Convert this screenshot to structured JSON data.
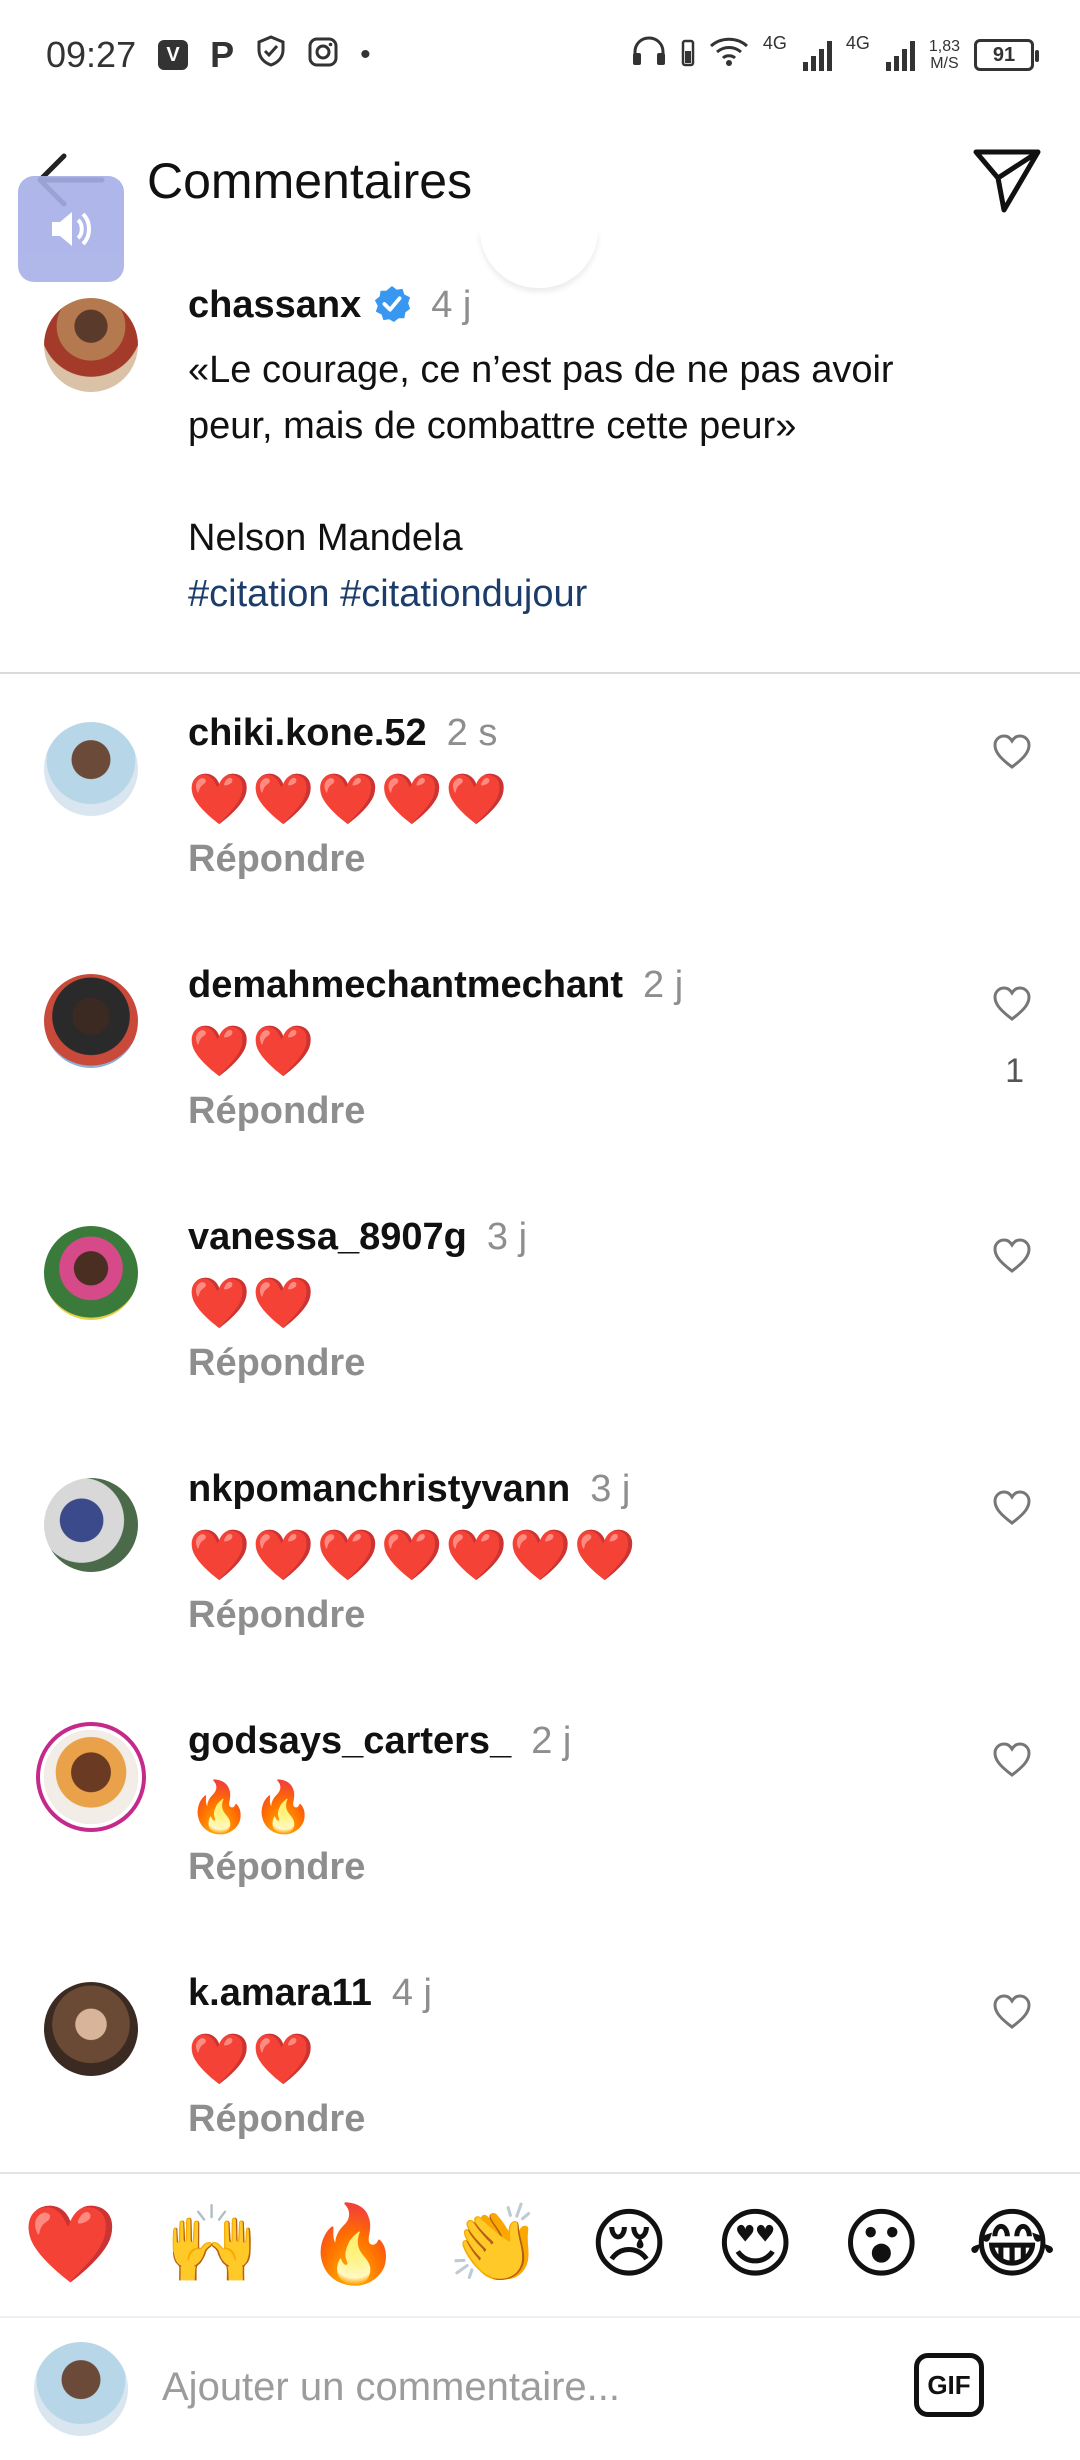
{
  "status_bar": {
    "time": "09:27",
    "net1": "4G",
    "net2": "4G",
    "speed_value": "1,83",
    "speed_unit": "M/S",
    "battery": "91"
  },
  "header": {
    "title": "Commentaires",
    "back_icon": "arrow-left-icon",
    "send_icon": "paper-plane-icon"
  },
  "caption": {
    "username": "chassanx",
    "verified": true,
    "time": "4 j",
    "line1": "«Le courage, ce n’est pas de ne pas avoir",
    "line2": "peur, mais de combattre cette peur»",
    "line3": "Nelson Mandela",
    "hashtag1": "#citation",
    "hashtag2": "#citationdujour"
  },
  "comments": [
    {
      "username": "chiki.kone.52",
      "time": "2 s",
      "text": "❤️❤️❤️❤️❤️",
      "reply": "Répondre",
      "likes": ""
    },
    {
      "username": "demahmechantmechant",
      "time": "2 j",
      "text": "❤️❤️",
      "reply": "Répondre",
      "likes": "1"
    },
    {
      "username": "vanessa_8907g",
      "time": "3 j",
      "text": "❤️❤️",
      "reply": "Répondre",
      "likes": ""
    },
    {
      "username": "nkpomanchristyvann",
      "time": "3 j",
      "text": "❤️❤️❤️❤️❤️❤️❤️",
      "reply": "Répondre",
      "likes": ""
    },
    {
      "username": "godsays_carters_",
      "time": "2 j",
      "text": "🔥🔥",
      "reply": "Répondre",
      "likes": ""
    },
    {
      "username": "k.amara11",
      "time": "4 j",
      "text": "❤️❤️",
      "reply": "Répondre",
      "likes": ""
    }
  ],
  "emoji_bar": [
    "❤️",
    "🙌",
    "🔥",
    "👏",
    "😢",
    "😍",
    "😮",
    "😂"
  ],
  "composer": {
    "placeholder": "Ajouter un commentaire...",
    "gif_label": "GIF"
  },
  "colors": {
    "hashtag": "#1c3d6b",
    "secondary_text": "#8e8e8e",
    "verified": "#3897f0",
    "story_ring": "#c52a8b"
  }
}
